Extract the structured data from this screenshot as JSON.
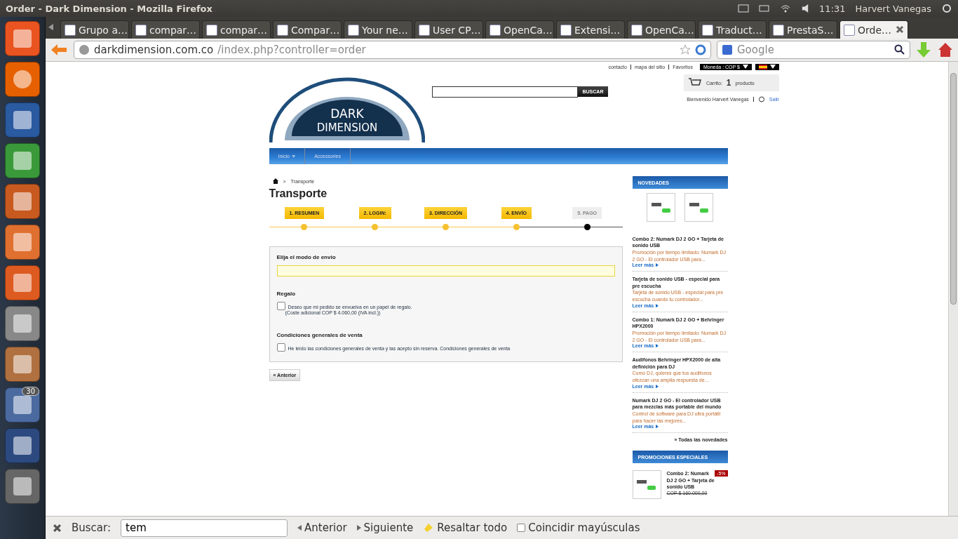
{
  "top_panel": {
    "title": "Order - Dark Dimension - Mozilla Firefox",
    "clock": "11:31",
    "user": "Harvert Vanegas"
  },
  "launcher": {
    "badge": "30"
  },
  "tabs": [
    {
      "label": "Grupo a…",
      "selected": false
    },
    {
      "label": "compar…",
      "selected": false
    },
    {
      "label": "compar…",
      "selected": false
    },
    {
      "label": "Compar…",
      "selected": false
    },
    {
      "label": "Your ne…",
      "selected": false
    },
    {
      "label": "User CP…",
      "selected": false
    },
    {
      "label": "OpenCa…",
      "selected": false
    },
    {
      "label": "Extensi…",
      "selected": false
    },
    {
      "label": "OpenCa…",
      "selected": false
    },
    {
      "label": "Traduct…",
      "selected": false
    },
    {
      "label": "PrestaS…",
      "selected": false
    },
    {
      "label": "Orde…",
      "selected": true
    }
  ],
  "address_bar": {
    "host": "darkdimension.com.co",
    "path": "/index.php?controller=order"
  },
  "search_bar": {
    "placeholder": "Google"
  },
  "header": {
    "links": [
      "contacto",
      "mapa del sitio",
      "Favoritos"
    ],
    "currency": "Moneda : COP $",
    "search_button": "BUSCAR",
    "cart": {
      "label": "Carrito:",
      "count": "1",
      "unit": "producto"
    },
    "welcome": "Bienvenido Harvert Vanegas",
    "logout": "Salir",
    "logo": {
      "line1": "DARK",
      "line2": "DIMENSION"
    }
  },
  "menu": [
    {
      "label": "Inicio",
      "kind": "dropdown"
    },
    {
      "label": "Accessories",
      "kind": "link"
    }
  ],
  "breadcrumb": {
    "separator": ">",
    "current": "Transporte"
  },
  "title": "Transporte",
  "steps": [
    {
      "label": "1. RESUMEN",
      "done": true
    },
    {
      "label": "2. LOGIN:",
      "done": true
    },
    {
      "label": "3. DIRECCIÓN",
      "done": true
    },
    {
      "label": "4. ENVÍO",
      "done": true
    },
    {
      "label": "5. PAGO",
      "done": false
    }
  ],
  "shipping": {
    "heading": "Elija el modo de envio"
  },
  "gift": {
    "heading": "Regalo",
    "checked": false,
    "text": "Deseo que mi pedido se envuelva en un papel de regalo.",
    "note": "(Coste adicional COP $ 4.060,00 (IVA incl.))"
  },
  "terms": {
    "heading": "Condiciones generales de venta",
    "checked": false,
    "text": "He leído las condiciones generales de venta y las acepto sin reserva.",
    "link": "Condiciones generales de venta"
  },
  "back_button": "« Anterior",
  "new_products": {
    "title": "NOVEDADES",
    "items": [
      {
        "title": "Combo 2: Numark DJ 2 GO + Tarjeta de sonido USB",
        "desc": "Promoción por tiempo limitado: Numark DJ 2 GO - El controlador USB para...",
        "more": "Leer más"
      },
      {
        "title": "Tarjeta de sonido USB - especial para pre escucha",
        "desc": "Tarjeta de sonido USB - especial para pre escucha cuando tu controlador...",
        "more": "Leer más"
      },
      {
        "title": "Combo 1: Numark DJ 2 GO + Behringer HPX2000",
        "desc": "Promoción por tiempo limitado: Numark DJ 2 GO - El controlador USB para...",
        "more": "Leer más"
      },
      {
        "title": "Audifonos Behringer HPX2000 de alta definición para DJ",
        "desc": "Como DJ, quieres que tus audifonos ofezcan una amplia respuesta de...",
        "more": "Leer más"
      },
      {
        "title": "Numark DJ 2 GO - El controlador USB para mezclas más portable del mundo",
        "desc": "Control de software para DJ ultra portátil para hacer las mejores...",
        "more": "Leer más"
      }
    ],
    "all_link": "» Todas las novedades"
  },
  "specials": {
    "title": "PROMOCIONES ESPECIALES",
    "item": {
      "title": "Combo 2: Numark DJ 2 GO + Tarjeta de sonido USB",
      "badge": "-5%",
      "price": "COP $ 160.000,00"
    }
  },
  "find_bar": {
    "label": "Buscar:",
    "value": "tem",
    "prev": "Anterior",
    "next": "Siguiente",
    "highlight": "Resaltar todo",
    "match_case": {
      "label": "Coincidir mayúsculas",
      "checked": false
    }
  }
}
